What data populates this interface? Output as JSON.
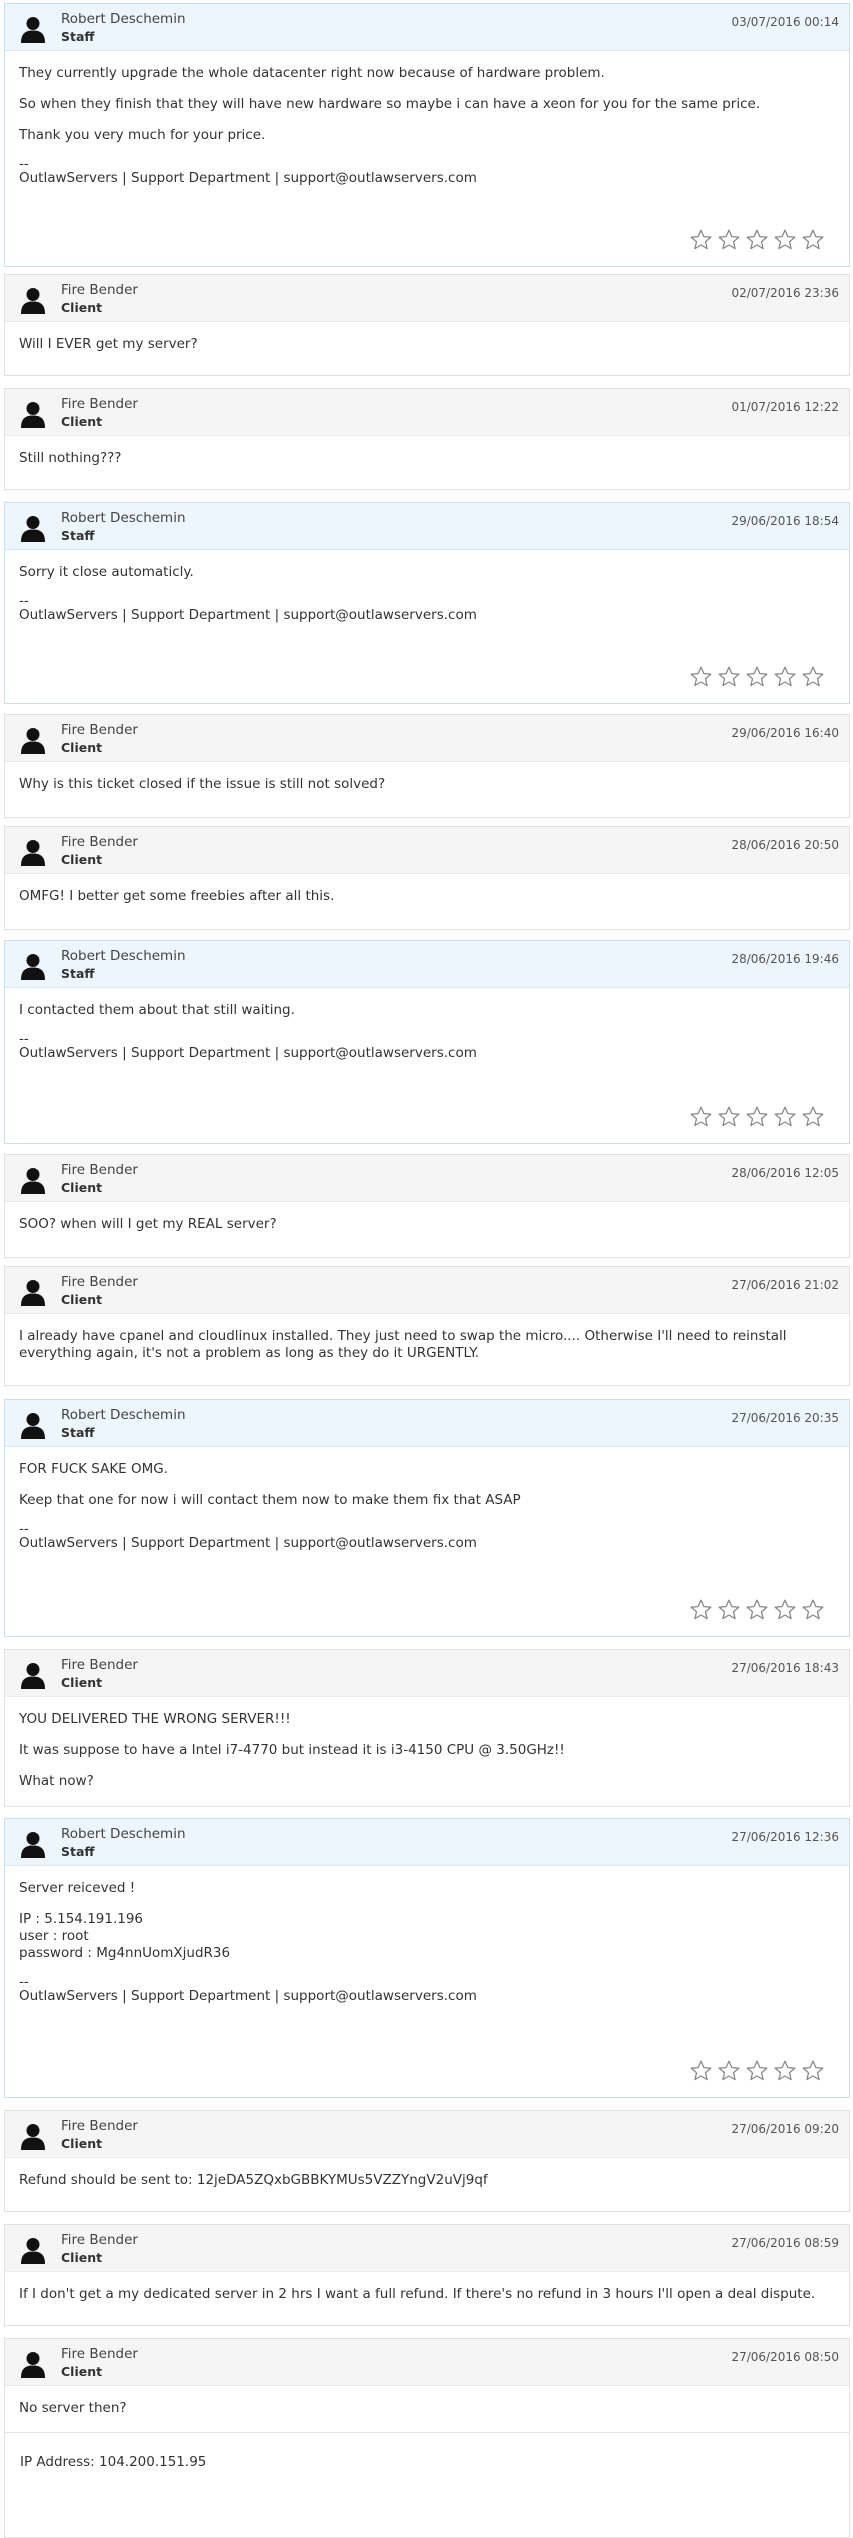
{
  "ticket": {
    "signature_sep": "--",
    "signature": "OutlawServers | Support Department | support@outlawservers.com",
    "messages": [
      {
        "author": "Robert Deschemin",
        "role": "Staff",
        "date": "03/07/2016 00:14",
        "paras": [
          [
            "They currently upgrade the whole datacenter right now because of hardware problem."
          ],
          [
            "So when they finish that they will have new hardware so maybe i can have a xeon for you for the same price."
          ],
          [
            "Thank you very much for your price."
          ]
        ],
        "rating": 0
      },
      {
        "author": "Fire Bender",
        "role": "Client",
        "date": "02/07/2016 23:36",
        "paras": [
          [
            "Will I EVER get my server?"
          ]
        ]
      },
      {
        "author": "Fire Bender",
        "role": "Client",
        "date": "01/07/2016 12:22",
        "paras": [
          [
            "Still nothing???"
          ]
        ]
      },
      {
        "author": "Robert Deschemin",
        "role": "Staff",
        "date": "29/06/2016 18:54",
        "paras": [
          [
            "Sorry it close automaticly."
          ]
        ],
        "rating": 0
      },
      {
        "author": "Fire Bender",
        "role": "Client",
        "date": "29/06/2016 16:40",
        "paras": [
          [
            "Why is this ticket closed if the issue is still not solved?"
          ]
        ]
      },
      {
        "author": "Fire Bender",
        "role": "Client",
        "date": "28/06/2016 20:50",
        "paras": [
          [
            "OMFG! I better get some freebies after all this."
          ]
        ]
      },
      {
        "author": "Robert Deschemin",
        "role": "Staff",
        "date": "28/06/2016 19:46",
        "paras": [
          [
            "I contacted them about that still waiting."
          ]
        ],
        "rating": 0
      },
      {
        "author": "Fire Bender",
        "role": "Client",
        "date": "28/06/2016 12:05",
        "paras": [
          [
            "SOO? when will I get my REAL server?"
          ]
        ]
      },
      {
        "author": "Fire Bender",
        "role": "Client",
        "date": "27/06/2016 21:02",
        "paras": [
          [
            "I already have cpanel and cloudlinux installed. They just need to swap the micro.... Otherwise I'll need to reinstall",
            "everything again, it's not a problem as long as they do it URGENTLY."
          ]
        ]
      },
      {
        "author": "Robert Deschemin",
        "role": "Staff",
        "date": "27/06/2016 20:35",
        "paras": [
          [
            "FOR FUCK SAKE OMG."
          ],
          [
            "Keep that one for now i will contact them now to make them fix that ASAP"
          ]
        ],
        "rating": 0
      },
      {
        "author": "Fire Bender",
        "role": "Client",
        "date": "27/06/2016 18:43",
        "paras": [
          [
            "YOU DELIVERED THE WRONG SERVER!!!"
          ],
          [
            "It was suppose to have a Intel i7-4770 but instead it is i3-4150 CPU @ 3.50GHz!!"
          ],
          [
            "What now?"
          ]
        ]
      },
      {
        "author": "Robert Deschemin",
        "role": "Staff",
        "date": "27/06/2016 12:36",
        "paras": [
          [
            "Server reiceved !"
          ],
          [
            "IP : 5.154.191.196",
            "user : root",
            "password : Mg4nnUomXjudR36"
          ]
        ],
        "rating": 0
      },
      {
        "author": "Fire Bender",
        "role": "Client",
        "date": "27/06/2016 09:20",
        "paras": [
          [
            "Refund should be sent to: 12jeDA5ZQxbGBBKYMUs5VZZYngV2uVj9qf"
          ]
        ]
      },
      {
        "author": "Fire Bender",
        "role": "Client",
        "date": "27/06/2016 08:59",
        "paras": [
          [
            "If I don't get a my dedicated server in 2 hrs I want a full refund. If there's no refund in 3 hours I'll open a deal dispute."
          ]
        ]
      },
      {
        "author": "Fire Bender",
        "role": "Client",
        "date": "27/06/2016 08:50",
        "paras": [
          [
            "No server then?"
          ]
        ]
      }
    ],
    "ip_address_line": "IP Address: 104.200.151.95"
  },
  "icons": {
    "avatar": "user-silhouette-icon",
    "star": "star-outline-icon"
  },
  "colors": {
    "staff_header": "#edf5fd",
    "client_header": "#f5f5f5",
    "staff_border": "#c9dff2"
  }
}
